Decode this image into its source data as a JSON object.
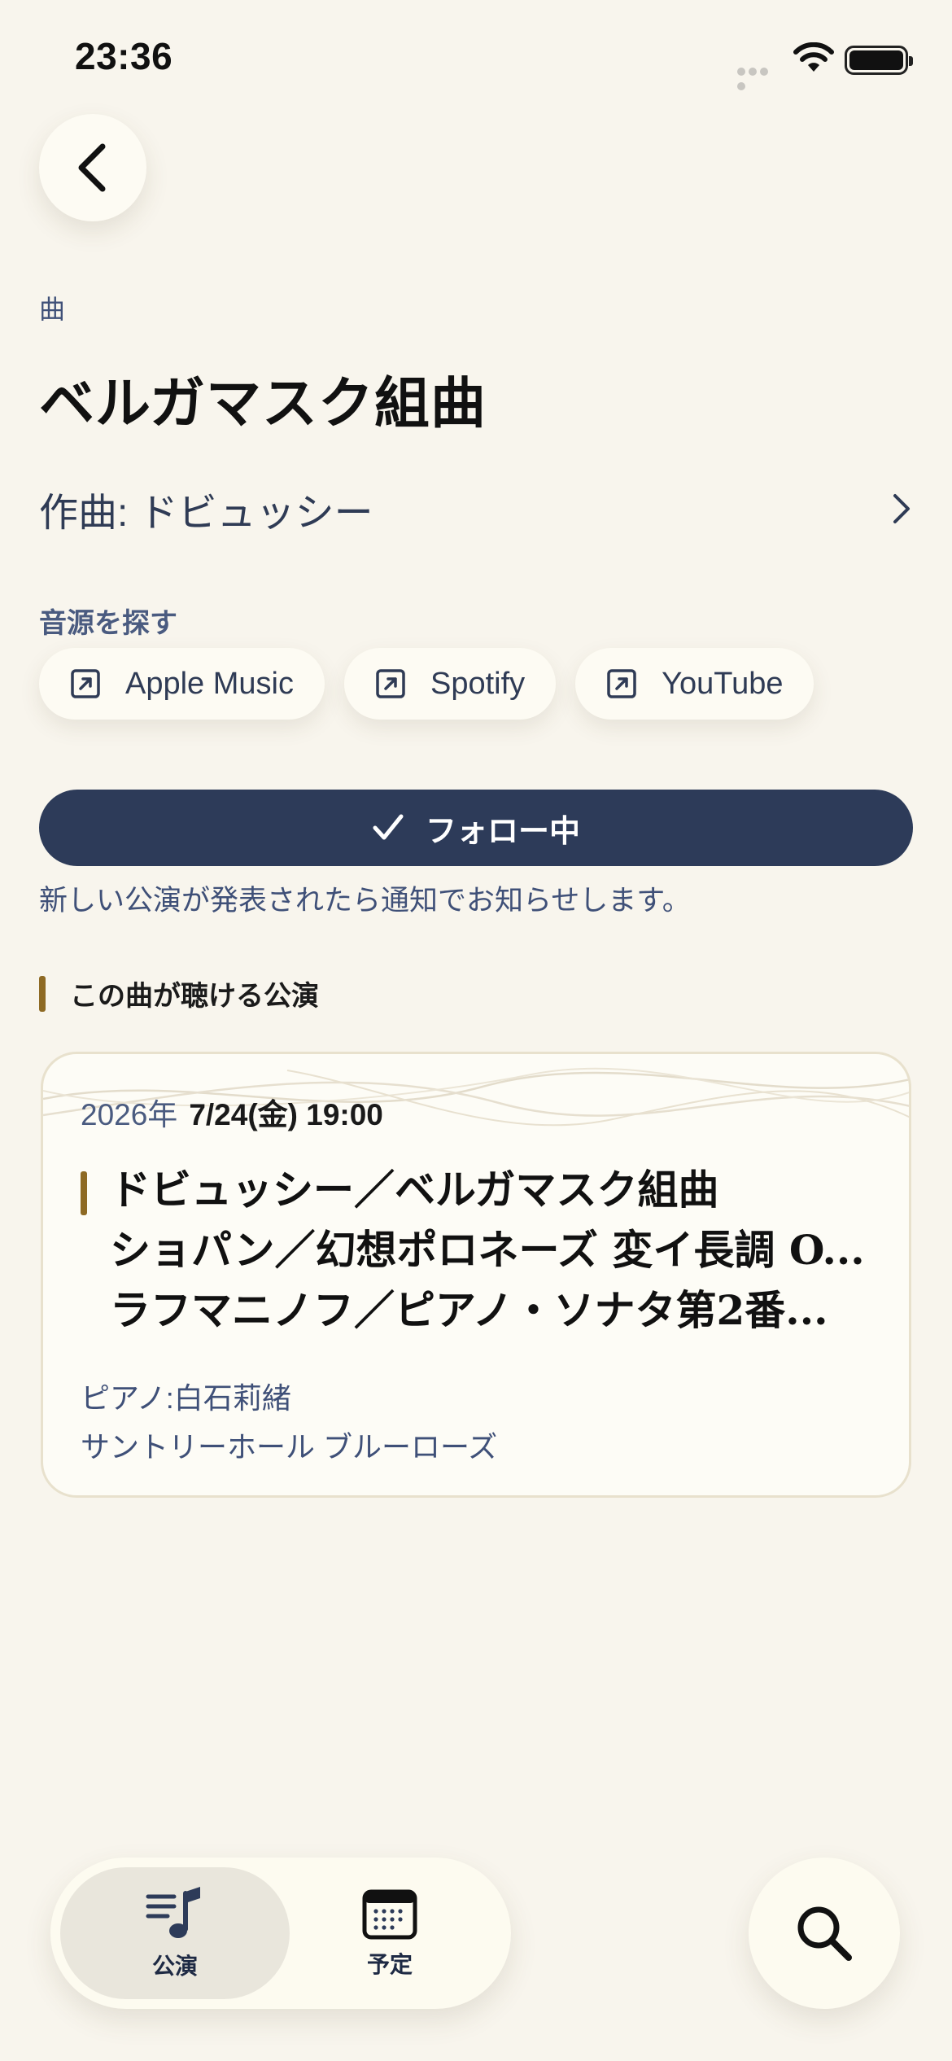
{
  "status": {
    "time": "23:36"
  },
  "kind_label": "曲",
  "piece_title": "ベルガマスク組曲",
  "composer": "作曲: ドビュッシー",
  "sources": {
    "label": "音源を探す",
    "items": [
      {
        "label": "Apple Music",
        "icon": "external-link-icon"
      },
      {
        "label": "Spotify",
        "icon": "external-link-icon"
      },
      {
        "label": "YouTube",
        "icon": "external-link-icon"
      }
    ]
  },
  "follow": {
    "label": "フォロー中",
    "note": "新しい公演が発表されたら通知でお知らせします。"
  },
  "section_title": "この曲が聴ける公演",
  "concert": {
    "year": "2026年",
    "date": "7/24(金) 19:00",
    "program": [
      "ドビュッシー／ベルガマスク組曲",
      "ショパン／幻想ポロネーズ 変イ長調 O...",
      "ラフマニノフ／ピアノ・ソナタ第2番..."
    ],
    "performer": "ピアノ:白石莉緒",
    "venue": "サントリーホール ブルーローズ"
  },
  "tabs": [
    {
      "label": "公演",
      "icon": "music-list-icon",
      "active": true
    },
    {
      "label": "予定",
      "icon": "calendar-icon",
      "active": false
    }
  ],
  "colors": {
    "background": "#f8f5ed",
    "navy": "#2d3b59",
    "accent_gold": "#8e6a24"
  }
}
